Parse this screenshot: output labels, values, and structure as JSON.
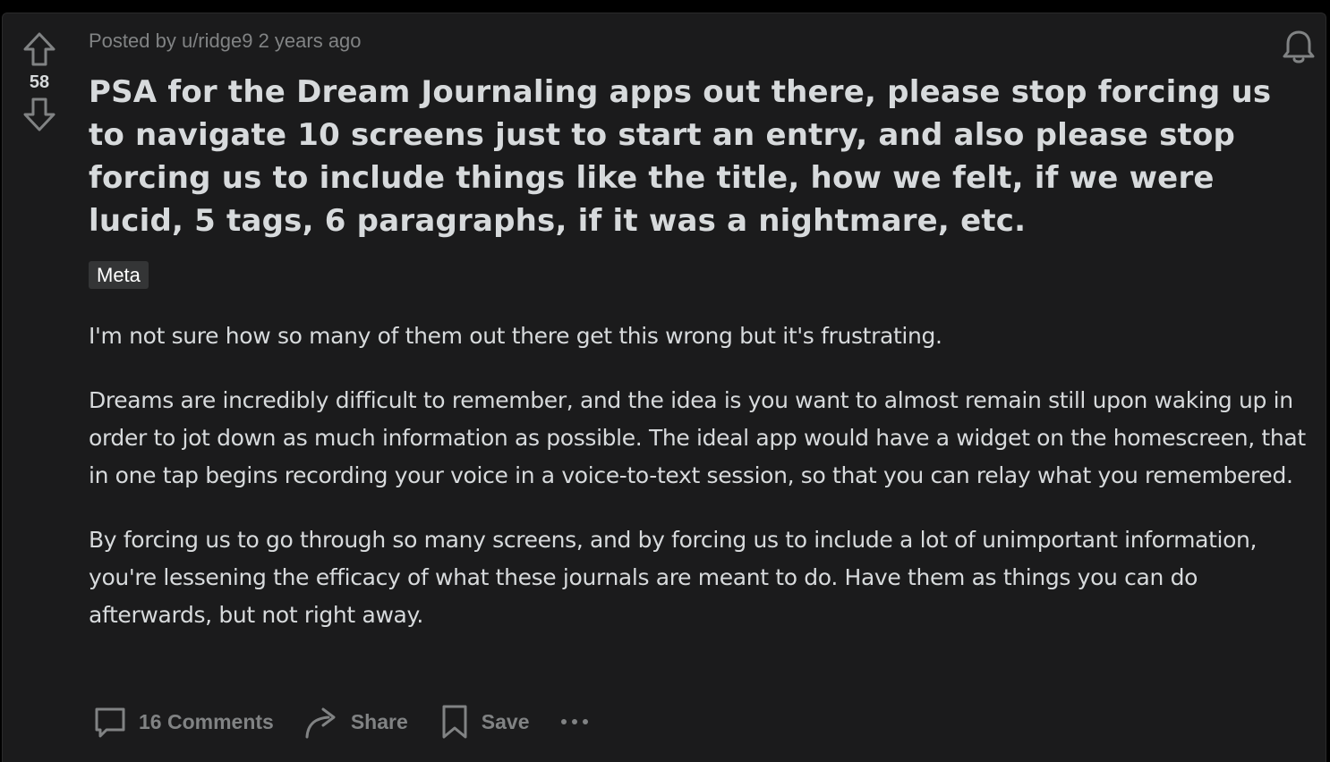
{
  "post": {
    "score": "58",
    "meta": "Posted by u/ridge9 2 years ago",
    "title": "PSA for the Dream Journaling apps out there, please stop forcing us to navigate 10 screens just to start an entry, and also please stop forcing us to include things like the title, how we felt, if we were lucid, 5 tags, 6 paragraphs, if it was a nightmare, etc.",
    "flair": "Meta",
    "body": [
      "I'm not sure how so many of them out there get this wrong but it's frustrating.",
      "Dreams are incredibly difficult to remember, and the idea is you want to almost remain still upon waking up in order to jot down as much information as possible. The ideal app would have a widget on the homescreen, that in one tap begins recording your voice in a voice-to-text session, so that you can relay what you remembered.",
      "By forcing us to go through so many screens, and by forcing us to include a lot of unimportant information, you're lessening the efficacy of what these journals are meant to do. Have them as things you can do afterwards, but not right away."
    ]
  },
  "actions": {
    "comments_label": "16 Comments",
    "share_label": "Share",
    "save_label": "Save"
  },
  "icons": {
    "upvote": "arrow-up-icon",
    "downvote": "arrow-down-icon",
    "notifications": "bell-icon",
    "comments": "comment-bubble-icon",
    "share": "share-arrow-icon",
    "save": "bookmark-icon",
    "more": "ellipsis-icon"
  },
  "colors": {
    "background": "#000000",
    "card": "#1b1b1c",
    "text": "#d7dadc",
    "muted": "#818384",
    "flair_bg": "#343536"
  }
}
